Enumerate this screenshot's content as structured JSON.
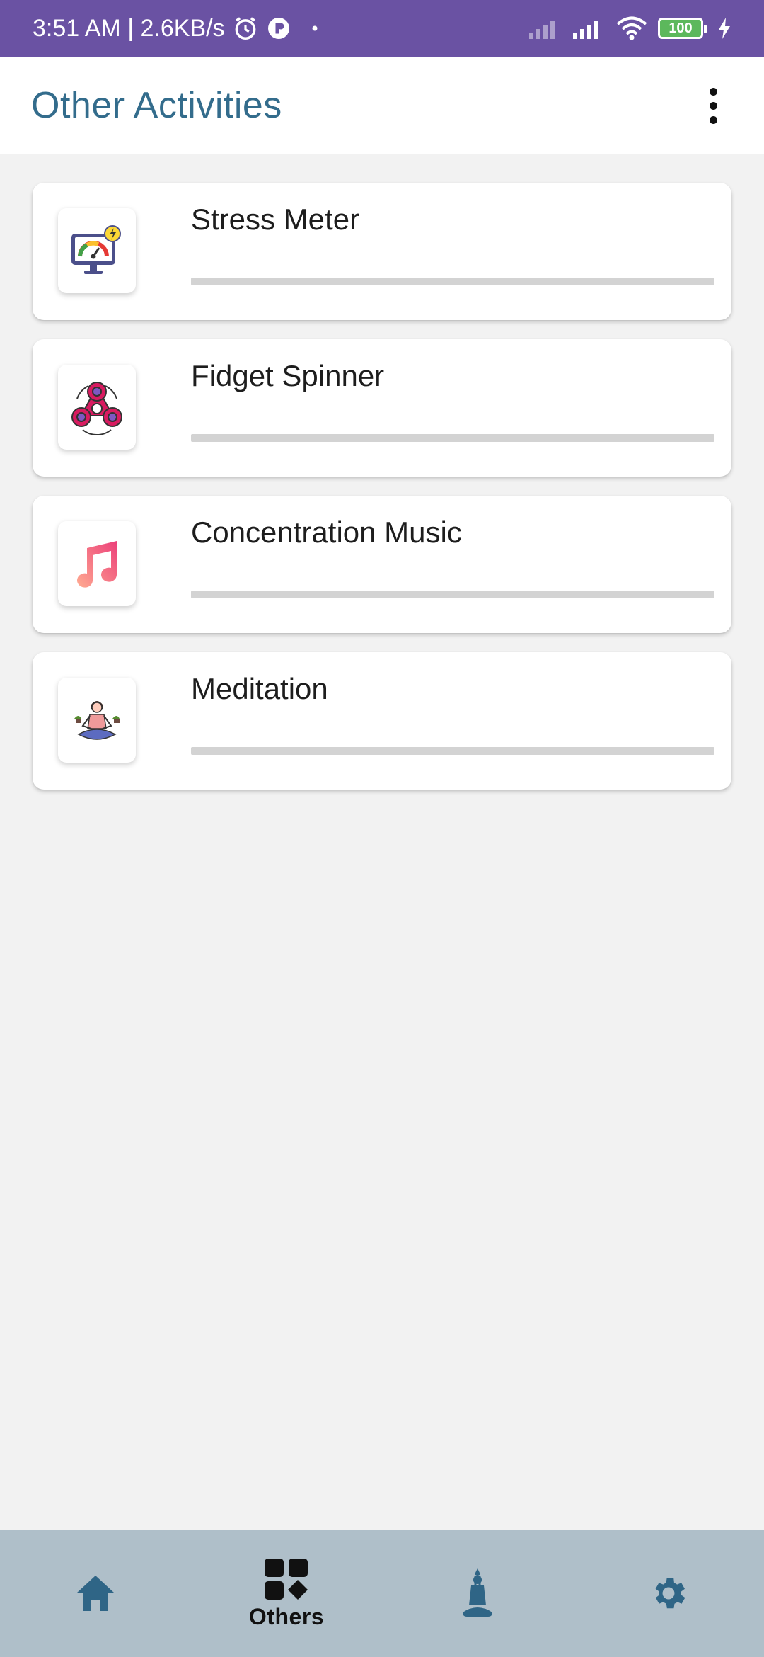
{
  "status_bar": {
    "time_speed": "3:51 AM | 2.6KB/s",
    "battery": "100",
    "icons": [
      "alarm-icon",
      "app-notification-icon",
      "dot-icon",
      "signal-weak-icon",
      "signal-icon",
      "wifi-icon",
      "battery-icon",
      "charging-icon"
    ]
  },
  "app_bar": {
    "title": "Other Activities",
    "menu_icon": "more-vertical-icon"
  },
  "activities": [
    {
      "title": "Stress Meter",
      "icon": "stress-meter-icon",
      "progress": 0
    },
    {
      "title": "Fidget Spinner",
      "icon": "fidget-spinner-icon",
      "progress": 0
    },
    {
      "title": "Concentration Music",
      "icon": "music-note-icon",
      "progress": 0
    },
    {
      "title": "Meditation",
      "icon": "meditation-icon",
      "progress": 0
    }
  ],
  "bottom_nav": {
    "items": [
      {
        "icon": "home-icon",
        "label": ""
      },
      {
        "icon": "others-grid-icon",
        "label": "Others",
        "selected": true
      },
      {
        "icon": "yoga-icon",
        "label": ""
      },
      {
        "icon": "gear-icon",
        "label": ""
      }
    ]
  },
  "colors": {
    "status_bar": "#6a52a3",
    "title": "#336c8c",
    "nav_bg": "#afbfc9",
    "nav_icon": "#2f6586"
  }
}
